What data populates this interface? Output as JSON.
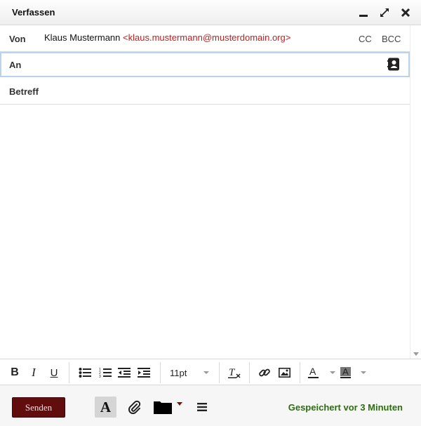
{
  "window": {
    "title": "Verfassen"
  },
  "header": {
    "from_label": "Von",
    "from_name": "Klaus Mustermann",
    "from_email": "<klaus.mustermann@musterdomain.org>",
    "cc_label": "CC",
    "bcc_label": "BCC",
    "to_label": "An",
    "to_value": "",
    "subject_label": "Betreff",
    "subject_value": ""
  },
  "body": {
    "value": ""
  },
  "toolbar": {
    "bold": "B",
    "italic": "I",
    "underline": "U",
    "font_size": "11pt",
    "text_color_glyph": "A",
    "bg_color_glyph": "A",
    "clear_format_glyph": "T"
  },
  "footer": {
    "send_label": "Senden",
    "format_toggle": "A",
    "saved_status": "Gespeichert vor 3 Minuten"
  },
  "colors": {
    "send_bg": "#620d0d",
    "email_red": "#c21d1d",
    "saved_green": "#2e6b12",
    "focus_border": "#b8d4ea"
  },
  "icons": [
    "minimize-icon",
    "maximize-icon",
    "close-icon",
    "address-book-icon",
    "bullet-list-icon",
    "numbered-list-icon",
    "outdent-icon",
    "indent-icon",
    "clear-format-icon",
    "link-icon",
    "image-icon",
    "text-color-icon",
    "background-color-icon",
    "attachment-icon",
    "folder-icon",
    "menu-icon"
  ]
}
